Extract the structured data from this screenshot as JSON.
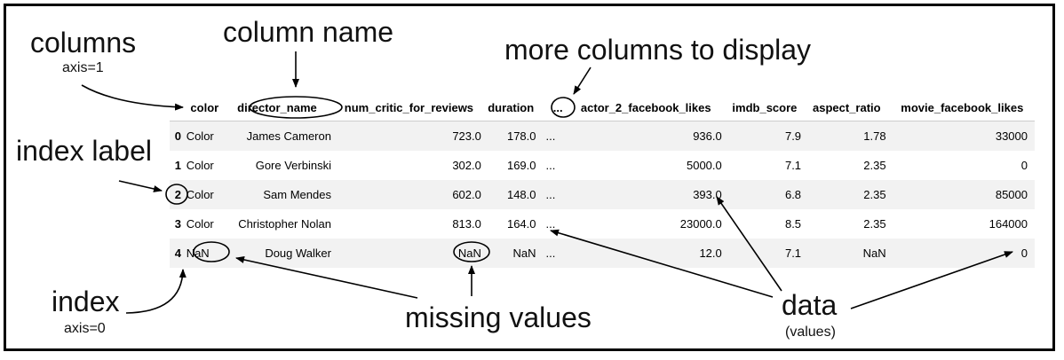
{
  "annotations": {
    "columns": "columns",
    "columns_axis": "axis=1",
    "column_name": "column name",
    "more_columns": "more columns to display",
    "index_label": "index label",
    "index": "index",
    "index_axis": "axis=0",
    "missing_values": "missing values",
    "data": "data",
    "data_sub": "(values)"
  },
  "table": {
    "headers": [
      "color",
      "director_name",
      "num_critic_for_reviews",
      "duration",
      "...",
      "actor_2_facebook_likes",
      "imdb_score",
      "aspect_ratio",
      "movie_facebook_likes"
    ],
    "rows": [
      {
        "index": "0",
        "cells": [
          "Color",
          "James Cameron",
          "723.0",
          "178.0",
          "...",
          "936.0",
          "7.9",
          "1.78",
          "33000"
        ]
      },
      {
        "index": "1",
        "cells": [
          "Color",
          "Gore Verbinski",
          "302.0",
          "169.0",
          "...",
          "5000.0",
          "7.1",
          "2.35",
          "0"
        ]
      },
      {
        "index": "2",
        "cells": [
          "Color",
          "Sam Mendes",
          "602.0",
          "148.0",
          "...",
          "393.0",
          "6.8",
          "2.35",
          "85000"
        ]
      },
      {
        "index": "3",
        "cells": [
          "Color",
          "Christopher Nolan",
          "813.0",
          "164.0",
          "...",
          "23000.0",
          "8.5",
          "2.35",
          "164000"
        ]
      },
      {
        "index": "4",
        "cells": [
          "NaN",
          "Doug Walker",
          "NaN",
          "NaN",
          "...",
          "12.0",
          "7.1",
          "NaN",
          "0"
        ]
      }
    ]
  }
}
